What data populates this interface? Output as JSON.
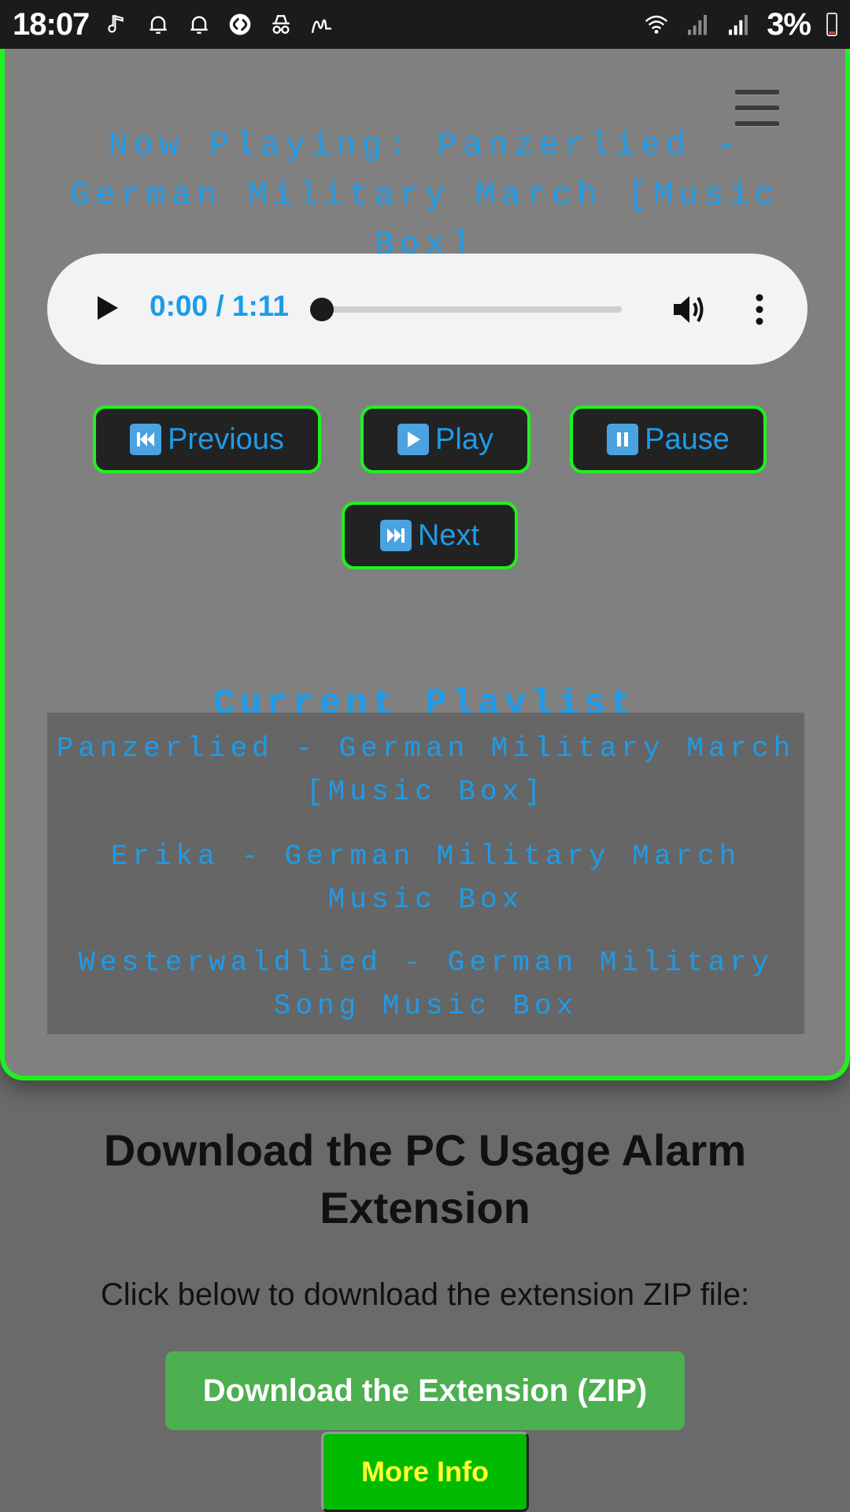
{
  "status_bar": {
    "time": "18:07",
    "battery_text": "3%",
    "icons": [
      "music-note-icon",
      "bell-icon",
      "bell-icon",
      "shazam-icon",
      "incognito-icon",
      "signature-icon",
      "wifi-icon",
      "signal-icon",
      "signal-icon",
      "battery-icon"
    ]
  },
  "player": {
    "now_playing": "Now Playing: Panzerlied - German Military March [Music Box]",
    "time_display": "0:00 / 1:11",
    "progress": 0,
    "accent_color": "#1e9be8",
    "border_color": "#1ef21e"
  },
  "controls": {
    "previous": "Previous",
    "play": "Play",
    "pause": "Pause",
    "next": "Next"
  },
  "playlist": {
    "title": "Current Playlist",
    "items": [
      "Panzerlied - German Military March [Music Box]",
      "Erika - German Military March Music Box",
      "Westerwaldlied - German Military Song Music Box"
    ]
  },
  "download": {
    "title": "Download the PC Usage Alarm Extension",
    "text": "Click below to download the extension ZIP file:",
    "button": "Download the Extension (ZIP)",
    "info_button": "More Info",
    "button_color": "#4caf50"
  }
}
